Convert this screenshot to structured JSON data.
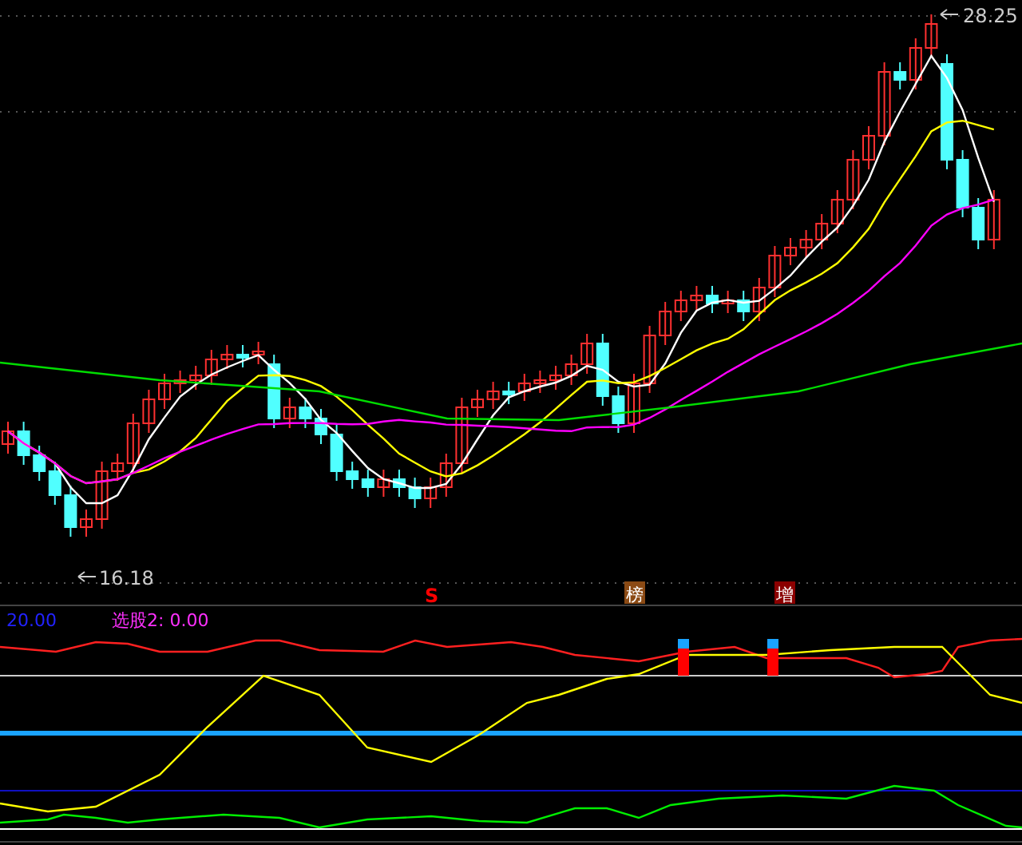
{
  "price_chart": {
    "high_label": "28.25",
    "low_label": "16.18"
  },
  "signals": [
    {
      "text": "S",
      "kind": "letter",
      "color": "#ff0000"
    },
    {
      "text": "榜",
      "kind": "tag",
      "color": "#8b4a14"
    },
    {
      "text": "增",
      "kind": "tag",
      "color": "#8b0000"
    }
  ],
  "indicator": {
    "value": "20.00",
    "pick_label": "选股2: 0.00"
  }
}
